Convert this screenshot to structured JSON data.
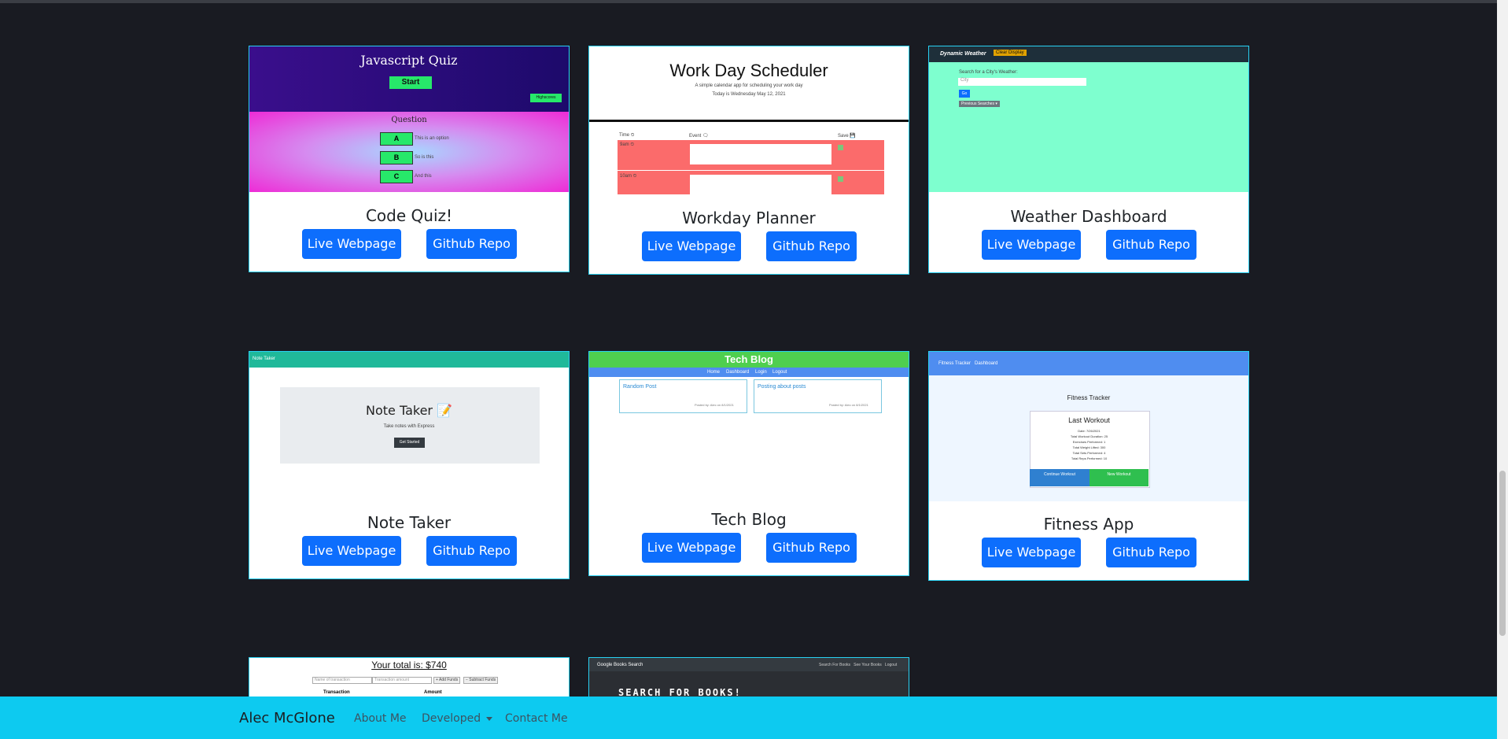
{
  "cards": [
    {
      "title": "Code Quiz!",
      "live": "Live Webpage",
      "repo": "Github Repo",
      "preview": {
        "heading": "Javascript Quiz",
        "start": "Start",
        "highscores": "Highscores",
        "question": "Question",
        "options": [
          {
            "key": "A",
            "text": "This is an option"
          },
          {
            "key": "B",
            "text": "So is this"
          },
          {
            "key": "C",
            "text": "And this"
          }
        ]
      }
    },
    {
      "title": "Workday Planner",
      "live": "Live Webpage",
      "repo": "Github Repo",
      "preview": {
        "heading": "Work Day Scheduler",
        "subtitle": "A simple calendar app for scheduling your work day",
        "date": "Today is Wednesday May 12, 2021",
        "col_time": "Time ⏲",
        "col_event": "Event 🗨",
        "col_save": "Save 💾",
        "row1": "9am ⏲",
        "row2": "10am ⏲"
      }
    },
    {
      "title": "Weather Dashboard",
      "live": "Live Webpage",
      "repo": "Github Repo",
      "preview": {
        "heading": "Dynamic Weather",
        "clear": "Clear Display",
        "search_label": "Search for a City's Weather:",
        "placeholder": "City",
        "go": "Go",
        "previous": "Previous Searches ▾"
      }
    },
    {
      "title": "Note Taker",
      "live": "Live Webpage",
      "repo": "Github Repo",
      "preview": {
        "nav": "Note Taker",
        "heading": "Note Taker 📝",
        "subtitle": "Take notes with Express",
        "cta": "Get Started"
      }
    },
    {
      "title": "Tech Blog",
      "live": "Live Webpage",
      "repo": "Github Repo",
      "preview": {
        "heading": "Tech Blog",
        "nav": [
          "Home",
          "Dashboard",
          "Login",
          "Logout"
        ],
        "posts": [
          {
            "title": "Random Post",
            "meta": "Posted by: Alec on 8/1/2021"
          },
          {
            "title": "Posting about posts",
            "meta": "Posted by: Alec on 8/1/2021"
          }
        ]
      }
    },
    {
      "title": "Fitness App",
      "live": "Live Webpage",
      "repo": "Github Repo",
      "preview": {
        "nav": [
          "Fitness Tracker",
          "Dashboard"
        ],
        "heading": "Fitness Tracker",
        "last": "Last Workout",
        "stats": [
          "Date: 7/26/2021",
          "Total Workout Duration: 25",
          "Exercises Performed: 1",
          "Total Weight Lifted: 300",
          "Total Sets Performed: 4",
          "Total Reps Performed: 10"
        ],
        "continue": "Continue Workout",
        "new": "New Workout"
      }
    },
    {
      "preview": {
        "total": "Your total is: $740",
        "name_ph": "Name of transaction",
        "amount_ph": "Transaction amount",
        "add": "+ Add Funds",
        "sub": "− Subtract Funds",
        "col1": "Transaction",
        "col2": "Amount"
      }
    },
    {
      "preview": {
        "brand": "Google Books Search",
        "links": "Search For Books   See Your Books   Logout",
        "heading": "SEARCH FOR BOOKS!"
      }
    }
  ],
  "footer": {
    "brand": "Alec McGlone",
    "about": "About Me",
    "developed": "Developed",
    "contact": "Contact Me"
  }
}
